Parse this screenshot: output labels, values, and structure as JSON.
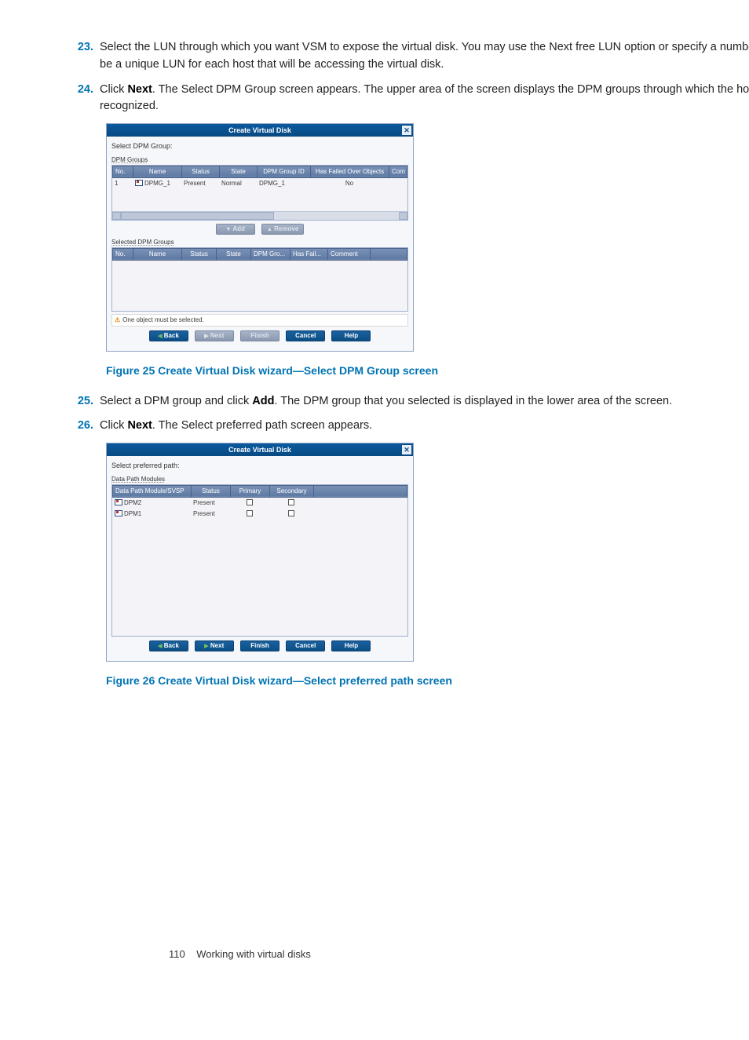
{
  "steps": {
    "s23": {
      "num": "23.",
      "text_a": "Select the LUN through which you want VSM to expose the virtual disk. You may use the Next free LUN option or specify a number. This must be a unique LUN for each host that will be accessing the virtual disk."
    },
    "s24": {
      "num": "24.",
      "text_a": "Click ",
      "bold": "Next",
      "text_b": ". The Select DPM Group screen appears. The upper area of the screen displays the DPM groups through which the host is recognized."
    },
    "s25": {
      "num": "25.",
      "text_a": "Select a DPM group and click ",
      "bold": "Add",
      "text_b": ". The DPM group that you selected is displayed in the lower area of the screen."
    },
    "s26": {
      "num": "26.",
      "text_a": "Click ",
      "bold": "Next",
      "text_b": ". The Select preferred path screen appears."
    }
  },
  "captions": {
    "fig25": "Figure 25 Create Virtual Disk wizard—Select DPM Group screen",
    "fig26": "Figure 26 Create Virtual Disk wizard—Select preferred path screen"
  },
  "dialog1": {
    "title": "Create Virtual Disk",
    "section_label": "Select DPM Group:",
    "top_label": "DPM Groups",
    "cols_top": [
      "No.",
      "Name",
      "Status",
      "State",
      "DPM Group ID",
      "Has Failed Over Objects",
      "Com"
    ],
    "row_top": {
      "no": "1",
      "name": "DPMG_1",
      "status": "Present",
      "state": "Normal",
      "gid": "DPMG_1",
      "failed": "No"
    },
    "btn_add": "Add",
    "btn_remove": "Remove",
    "sel_label": "Selected DPM Groups",
    "cols_sel": [
      "No.",
      "Name",
      "Status",
      "State",
      "DPM Gro...",
      "Has Fail...",
      "Comment",
      ""
    ],
    "warn": "One object must be selected.",
    "back": "Back",
    "next": "Next",
    "finish": "Finish",
    "cancel": "Cancel",
    "help": "Help"
  },
  "dialog2": {
    "title": "Create Virtual Disk",
    "section_label": "Select preferred path:",
    "top_label": "Data Path Modules",
    "cols": [
      "Data Path Module/SVSP",
      "Status",
      "Primary",
      "Secondary"
    ],
    "rows": [
      {
        "name": "DPM2",
        "status": "Present"
      },
      {
        "name": "DPM1",
        "status": "Present"
      }
    ],
    "back": "Back",
    "next": "Next",
    "finish": "Finish",
    "cancel": "Cancel",
    "help": "Help"
  },
  "footer": {
    "page": "110",
    "title": "Working with virtual disks"
  }
}
